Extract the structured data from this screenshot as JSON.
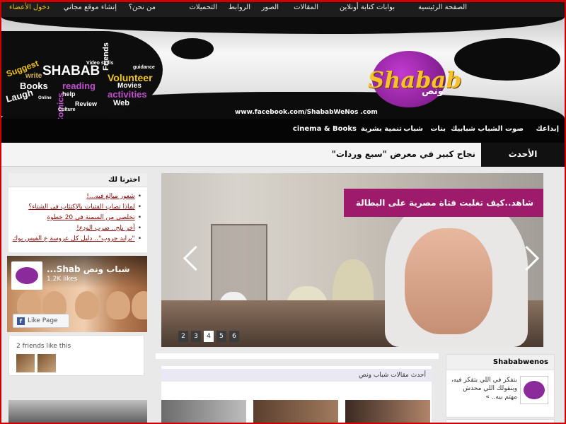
{
  "top_nav": {
    "items": [
      {
        "label": "الصفحة الرئيسية"
      },
      {
        "label": "بوابات كتابة أونلاين"
      },
      {
        "label": "المقالات"
      },
      {
        "label": "الصور"
      },
      {
        "label": "الروابط"
      },
      {
        "label": "التحميلات"
      },
      {
        "label": "من نحن؟"
      },
      {
        "label": "إنشاء موقع مجاني"
      },
      {
        "label": "دخول الأعضاء"
      }
    ]
  },
  "banner": {
    "words": [
      "Suggest",
      "SHABAB",
      "Video skills",
      "write",
      "Books",
      "reading",
      "Friends",
      "Volunteer",
      "guidance",
      "Movies",
      "activities",
      "help",
      "Comics",
      "Laugh",
      "Review",
      "Web",
      "Online",
      "Culture"
    ],
    "logo_text": "Shabab",
    "logo_sub": "ونص",
    "facebook_url": "www.facebook.com/ShababWeNos .com"
  },
  "main_nav": {
    "items": [
      {
        "label": "إبداعك"
      },
      {
        "label": "صوت الشباب"
      },
      {
        "label": "شبابيك"
      },
      {
        "label": "بنات"
      },
      {
        "label": "شباب"
      },
      {
        "label": "تنمية بشرية"
      },
      {
        "label": "cinema & Books"
      }
    ]
  },
  "ticker": {
    "latest_label": "الأحدث",
    "headline": "نجاح كبير في معرض \"سبع وردات\""
  },
  "picks": {
    "title": "اخترنا لك",
    "items": [
      "شعور ميالغ فيه...!",
      "لماذا تصاب الفتيات بالإكتئاب في الشتاء؟",
      "تخلصي من السمنة في 20 خطوة",
      "آخر بلح.. ضرب الودع!",
      "\"برايد جروب\".. دليل كل عروسة ع الفيس بوك"
    ]
  },
  "fb_widget": {
    "page_name": "شباب ونص Shab...",
    "likes": "1.2K likes",
    "like_button": "Like Page",
    "friends_text": "2 friends like this"
  },
  "slider": {
    "caption": "شاهد..كيف تغلبت فتاة مصرية على البطالة",
    "dots": [
      "2",
      "3",
      "4",
      "5",
      "6"
    ],
    "active_dot": "4"
  },
  "articles": {
    "title": "أحدث مقالات شباب ونص"
  },
  "right_widget": {
    "title": "Shababwenos",
    "text": "بنفكر في اللي بتفكر فيه، وبنقولك اللي محدش مهتم بيه.. »"
  },
  "colors": {
    "accent": "#9e1b6b",
    "topbar": "#1d1d1d",
    "nav": "#050505",
    "link": "#8a0b0b",
    "login": "#f2c51a",
    "frame": "#d10000"
  }
}
